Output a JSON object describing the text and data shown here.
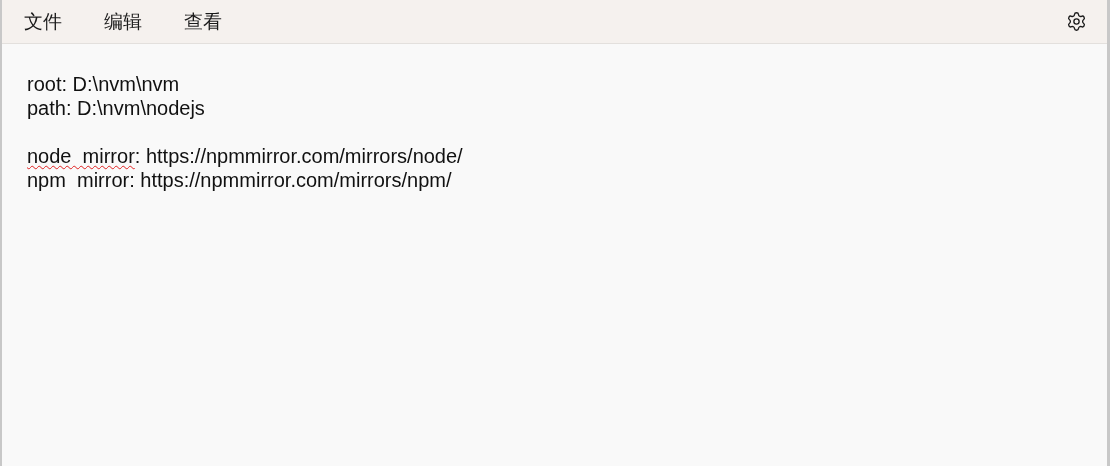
{
  "menu": [
    {
      "label": "文件"
    },
    {
      "label": "编辑"
    },
    {
      "label": "查看"
    }
  ],
  "document": {
    "paragraphs": [
      {
        "lines": [
          [
            {
              "text": "root: D:\\nvm\\nvm",
              "misspelled": false
            }
          ],
          [
            {
              "text": "path: D:\\nvm\\nodejs",
              "misspelled": false
            }
          ]
        ]
      },
      {
        "lines": [
          [
            {
              "text": "node  mirror",
              "misspelled": true
            },
            {
              "text": ": https://npmmirror.com/mirrors/node/",
              "misspelled": false
            }
          ],
          [
            {
              "text": "npm  mirror: https://npmmirror.com/mirrors/npm/",
              "misspelled": false
            }
          ]
        ]
      }
    ]
  }
}
